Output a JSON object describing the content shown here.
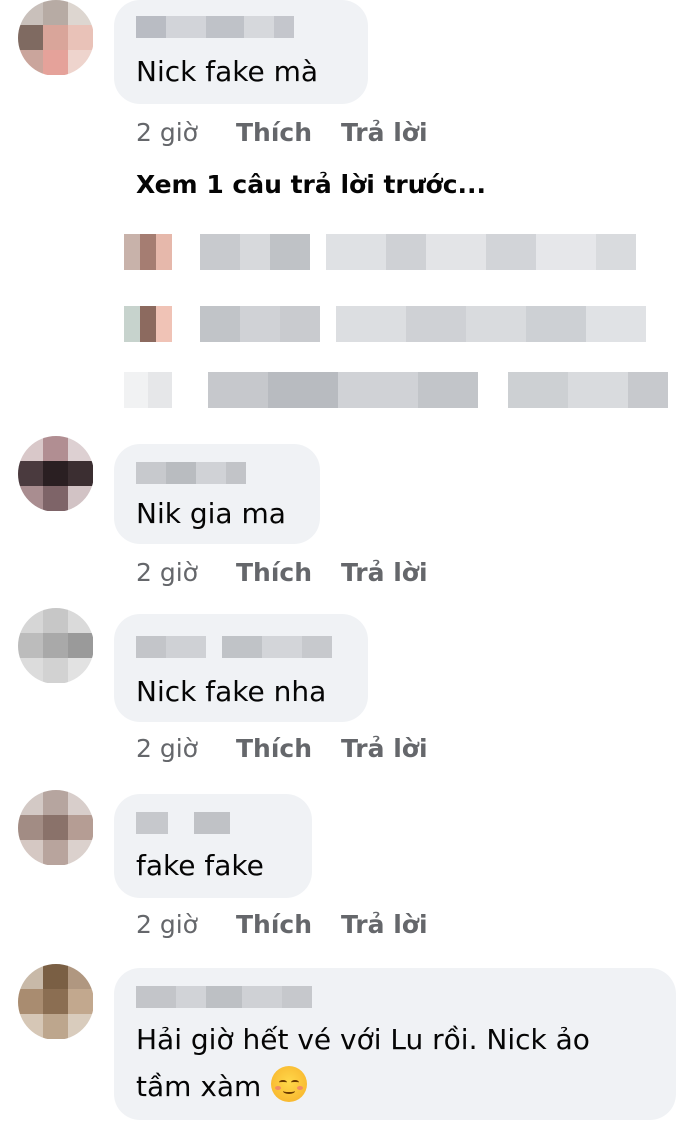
{
  "comments": [
    {
      "text": "Nick fake mà",
      "time": "2 giờ",
      "like": "Thích",
      "reply": "Trả lời",
      "more_replies": "Xem 1 câu trả lời trước..."
    },
    {
      "text": "Nik gia ma",
      "time": "2 giờ",
      "like": "Thích",
      "reply": "Trả lời"
    },
    {
      "text": "Nick fake nha",
      "time": "2 giờ",
      "like": "Thích",
      "reply": "Trả lời"
    },
    {
      "text": "fake fake",
      "time": "2 giờ",
      "like": "Thích",
      "reply": "Trả lời"
    },
    {
      "text_line1": "Hải giờ hết vé với Lu rồi. Nick ảo",
      "text_line2": "tầm xàm",
      "emoji": "relieved-face-icon"
    }
  ],
  "colors": {
    "bubble": "#f0f2f5",
    "meta": "#65676b",
    "text": "#050505"
  }
}
